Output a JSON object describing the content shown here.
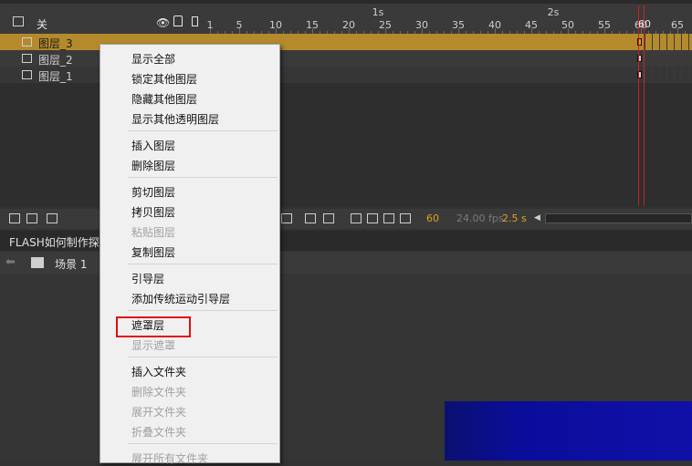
{
  "timeline": {
    "header_title": "关",
    "ruler_frames": [
      "1",
      "5",
      "10",
      "15",
      "20",
      "25",
      "30",
      "35",
      "40",
      "45",
      "50",
      "55",
      "60",
      "65"
    ],
    "ruler_seconds": [
      "1s",
      "2s"
    ],
    "current_frame": "60",
    "layers": [
      {
        "name": "图层_3",
        "selected": true
      },
      {
        "name": "图层_2",
        "selected": false
      },
      {
        "name": "图层_1",
        "selected": false
      }
    ],
    "status": {
      "frame": "60",
      "fps": "24.00 fps",
      "time": "2.5 s"
    }
  },
  "panel": {
    "title": "FLASH如何制作探照灯"
  },
  "scene": {
    "label": "场景 1"
  },
  "context_menu": {
    "groups": [
      [
        {
          "label": "显示全部",
          "enabled": true
        },
        {
          "label": "锁定其他图层",
          "enabled": true
        },
        {
          "label": "隐藏其他图层",
          "enabled": true
        },
        {
          "label": "显示其他透明图层",
          "enabled": true
        }
      ],
      [
        {
          "label": "插入图层",
          "enabled": true
        },
        {
          "label": "删除图层",
          "enabled": true
        }
      ],
      [
        {
          "label": "剪切图层",
          "enabled": true
        },
        {
          "label": "拷贝图层",
          "enabled": true
        },
        {
          "label": "粘贴图层",
          "enabled": false
        },
        {
          "label": "复制图层",
          "enabled": true
        }
      ],
      [
        {
          "label": "引导层",
          "enabled": true
        },
        {
          "label": "添加传统运动引导层",
          "enabled": true
        }
      ],
      [
        {
          "label": "遮罩层",
          "enabled": true
        },
        {
          "label": "显示遮罩",
          "enabled": false
        }
      ],
      [
        {
          "label": "插入文件夹",
          "enabled": true
        },
        {
          "label": "删除文件夹",
          "enabled": false
        },
        {
          "label": "展开文件夹",
          "enabled": false
        },
        {
          "label": "折叠文件夹",
          "enabled": false
        }
      ],
      [
        {
          "label": "展开所有文件夹",
          "enabled": false
        }
      ]
    ]
  },
  "colors": {
    "accent": "#e0a020",
    "highlight": "#e01010",
    "selected_layer": "#b48a2c"
  }
}
